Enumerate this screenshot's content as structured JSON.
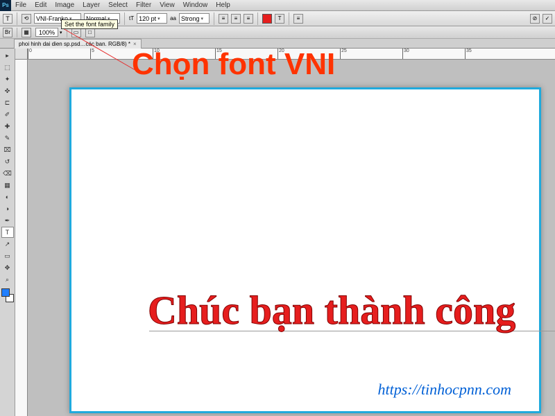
{
  "app": {
    "ps_label": "Ps"
  },
  "menu": {
    "items": [
      "File",
      "Edit",
      "Image",
      "Layer",
      "Select",
      "Filter",
      "View",
      "Window",
      "Help"
    ]
  },
  "options": {
    "tool_glyph": "T",
    "orient_glyph": "⟲",
    "font_family": "VNI-Franko",
    "font_style": "Normal",
    "size_glyph": "tT",
    "font_size": "120 pt",
    "aa_glyph": "aa",
    "anti_alias": "Strong",
    "align_icons": [
      "≡",
      "≡",
      "≡"
    ],
    "warp_glyph": "T",
    "panel_glyph": "≡",
    "swatch_color": "#e61e1e",
    "cancel_glyph": "⊘",
    "commit_glyph": "✓"
  },
  "appbar": {
    "bridge_glyph": "Br",
    "zoom_value": "100%",
    "layout_icons": [
      "▭",
      "▭",
      "▭"
    ],
    "view_glyph": "▦",
    "screen_glyph": "□"
  },
  "tabs": {
    "title": "phoi hinh dai dien sp.psd…các ban. RGB/8) *",
    "close": "×"
  },
  "tools": {
    "items": [
      {
        "g": "▸",
        "n": "move-tool"
      },
      {
        "g": "⬚",
        "n": "marquee-tool"
      },
      {
        "g": "✦",
        "n": "lasso-tool"
      },
      {
        "g": "✜",
        "n": "magic-wand-tool"
      },
      {
        "g": "⊏",
        "n": "crop-tool"
      },
      {
        "g": "✐",
        "n": "eyedropper-tool"
      },
      {
        "g": "✚",
        "n": "healing-brush-tool"
      },
      {
        "g": "✎",
        "n": "brush-tool"
      },
      {
        "g": "⌧",
        "n": "clone-stamp-tool"
      },
      {
        "g": "↺",
        "n": "history-brush-tool"
      },
      {
        "g": "⌫",
        "n": "eraser-tool"
      },
      {
        "g": "▦",
        "n": "gradient-tool"
      },
      {
        "g": "◐",
        "n": "blur-tool"
      },
      {
        "g": "◑",
        "n": "dodge-tool"
      },
      {
        "g": "✒",
        "n": "pen-tool"
      },
      {
        "g": "T",
        "n": "type-tool",
        "sel": true
      },
      {
        "g": "↗",
        "n": "path-selection-tool"
      },
      {
        "g": "▭",
        "n": "rectangle-tool"
      },
      {
        "g": "✥",
        "n": "hand-tool"
      },
      {
        "g": "⌕",
        "n": "zoom-tool"
      }
    ]
  },
  "ruler": {
    "h_ticks": [
      0,
      5,
      10,
      15,
      20,
      25,
      30,
      35
    ]
  },
  "canvas": {
    "tooltip": "Set the font family",
    "annotation": "Chọn font VNI",
    "main_text": "Chúc bạn thành công",
    "watermark": "https://tinhocpnn.com"
  }
}
